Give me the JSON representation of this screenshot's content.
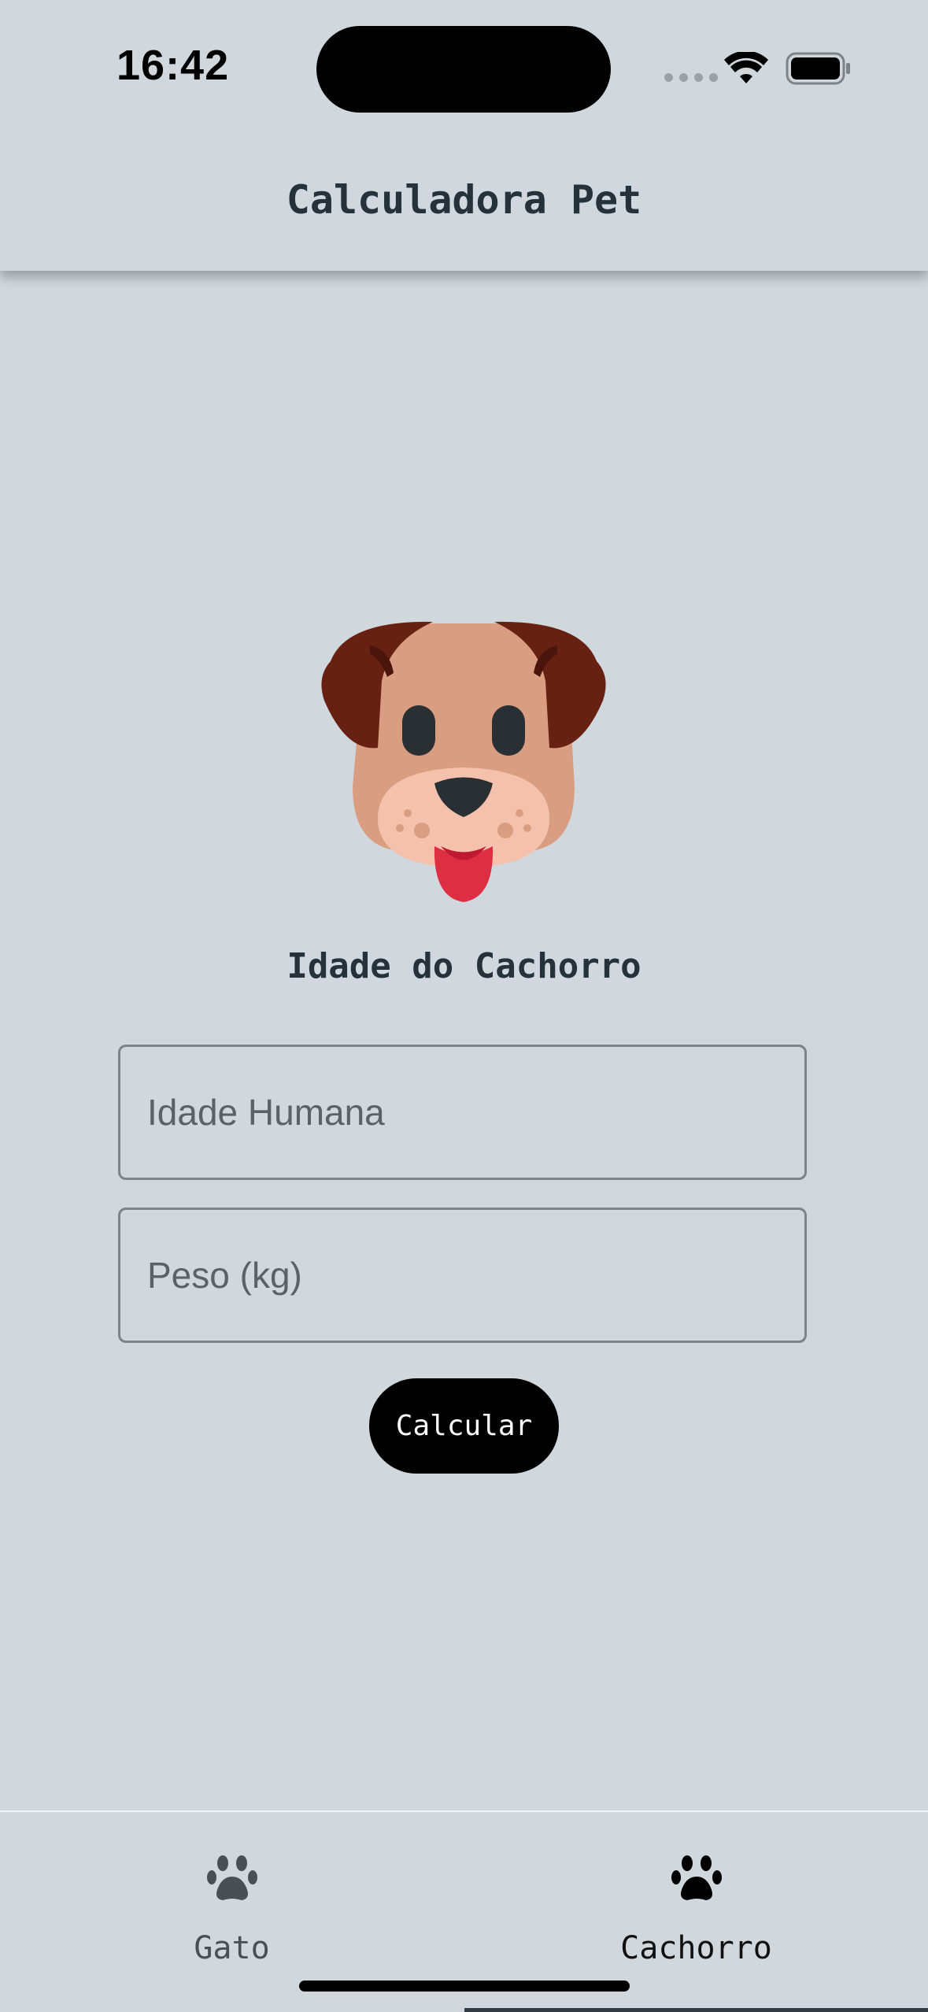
{
  "status_bar": {
    "time": "16:42"
  },
  "header": {
    "title": "Calculadora Pet"
  },
  "main": {
    "image_icon": "dog-face-icon",
    "section_title": "Idade do Cachorro",
    "age_field": {
      "placeholder": "Idade Humana",
      "value": ""
    },
    "weight_field": {
      "placeholder": "Peso (kg)",
      "value": ""
    },
    "calculate_label": "Calcular"
  },
  "tab_bar": {
    "tabs": [
      {
        "label": "Gato",
        "icon": "paw-icon",
        "active": false
      },
      {
        "label": "Cachorro",
        "icon": "paw-icon",
        "active": true
      }
    ]
  },
  "colors": {
    "background": "#d0d8dd",
    "text": "#253238",
    "button": "#000000",
    "button_text": "#ffffff"
  }
}
